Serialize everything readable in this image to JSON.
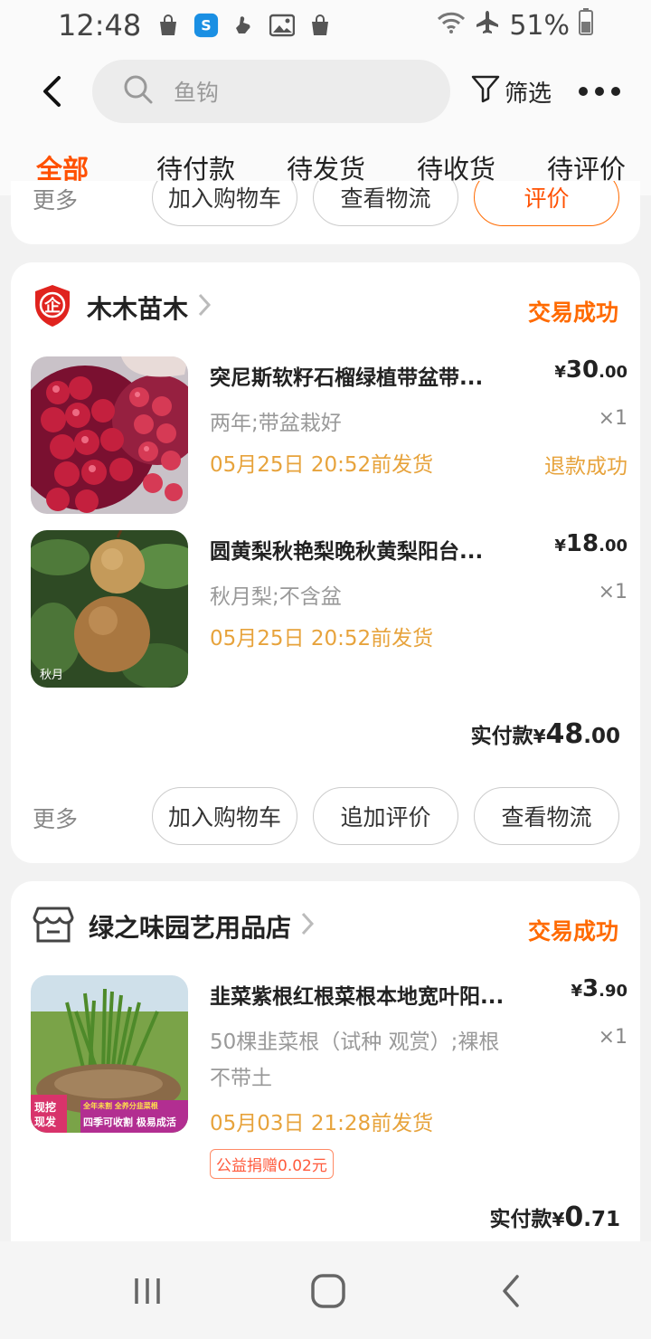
{
  "status_bar": {
    "time": "12:48",
    "battery": "51%"
  },
  "search": {
    "placeholder": "鱼钩"
  },
  "header": {
    "filter_label": "筛选"
  },
  "tabs": [
    {
      "label": "全部",
      "active": true
    },
    {
      "label": "待付款"
    },
    {
      "label": "待发货"
    },
    {
      "label": "待收货"
    },
    {
      "label": "待评价"
    }
  ],
  "top_card": {
    "more_label": "更多",
    "buttons": [
      "加入购物车",
      "查看物流",
      "评价"
    ]
  },
  "orders": [
    {
      "shop_name": "木木苗木",
      "status": "交易成功",
      "items": [
        {
          "title": "突尼斯软籽石榴绿植带盆带...",
          "spec": "两年;带盆栽好",
          "ship_time": "05月25日 20:52前发货",
          "price_main": "30",
          "price_cents": ".00",
          "qty": "×1",
          "refund": "退款成功"
        },
        {
          "title": "圆黄梨秋艳梨晚秋黄梨阳台...",
          "spec": "秋月梨;不含盆",
          "ship_time": "05月25日 20:52前发货",
          "price_main": "18",
          "price_cents": ".00",
          "qty": "×1",
          "thumb_caption": "秋月"
        }
      ],
      "total_label": "实付款",
      "total_main": "48",
      "total_cents": ".00",
      "more_label": "更多",
      "buttons": [
        "加入购物车",
        "追加评价",
        "查看物流"
      ]
    },
    {
      "shop_name": "绿之味园艺用品店",
      "status": "交易成功",
      "items": [
        {
          "title": "韭菜紫根红根菜根本地宽叶阳...",
          "spec_line1": "50棵韭菜根（试种 观赏）;裸根",
          "spec_line2": "不带土",
          "ship_time": "05月03日 21:28前发货",
          "price_main": "3",
          "price_cents": ".90",
          "qty": "×1",
          "charity": "公益捐赠0.02元",
          "thumb_badge_1": "现挖",
          "thumb_badge_2": "现发",
          "thumb_banner_top": "全年未割 全养分韭菜根",
          "thumb_banner_bottom": "四季可收割 极易成活"
        }
      ],
      "total_label": "实付款",
      "total_main": "0",
      "total_cents": ".71"
    }
  ],
  "colors": {
    "accent": "#ff5000",
    "status": "#ff6a00",
    "ship": "#e7a33c"
  }
}
